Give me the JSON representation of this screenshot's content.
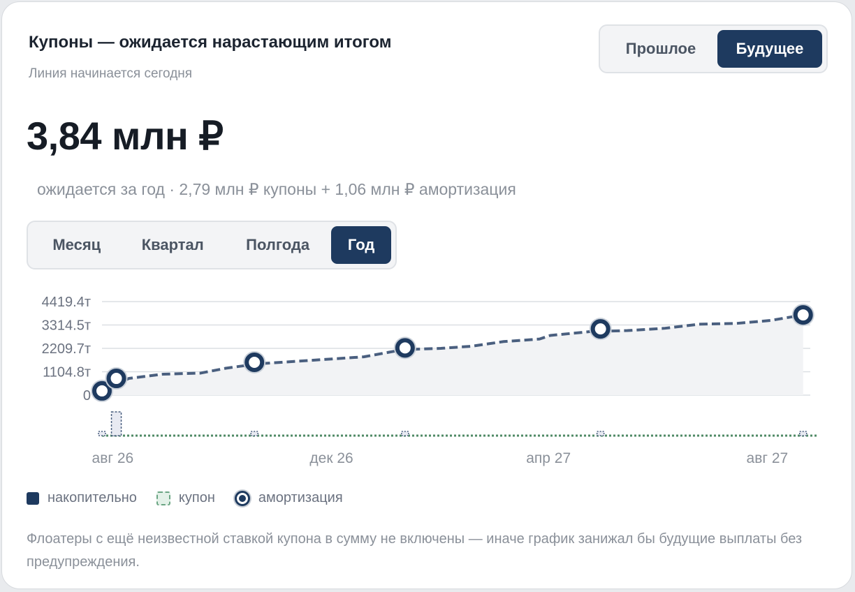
{
  "header": {
    "title": "Купоны — ожидается нарастающим итогом",
    "subtitle": "Линия начинается сегодня"
  },
  "time_toggle": {
    "options": [
      "Прошлое",
      "Будущее"
    ],
    "selected": "Будущее"
  },
  "summary": {
    "value": "3,84 млн ₽",
    "caption": "ожидается за год · 2,79 млн ₽ купоны + 1,06 млн ₽ амортизация"
  },
  "period_toggle": {
    "options": [
      "Месяц",
      "Квартал",
      "Полгода",
      "Год"
    ],
    "selected": "Год"
  },
  "legend": {
    "cumulative": "накопительно",
    "coupon": "купон",
    "amortization": "амортизация"
  },
  "footnote": "Флоатеры с ещё неизвестной ставкой купона в сумму не включены — иначе график занижал бы будущие выплаты без предупреждения.",
  "colors": {
    "accent": "#1e3a5f",
    "line": "#4a5f7f",
    "area": "#f2f3f5",
    "coupon": "#4f8a65",
    "grid": "#dcdfe3"
  },
  "chart_data": {
    "type": "line",
    "y_ticks": [
      "4419.4т",
      "3314.5т",
      "2209.7т",
      "1104.8т",
      "0"
    ],
    "y_tick_values": [
      4419.4,
      3314.5,
      2209.7,
      1104.8,
      0
    ],
    "x_ticks": [
      "авг 26",
      "дек 26",
      "апр 27",
      "авг 27"
    ],
    "x_tick_values": [
      "2026-08-07",
      "2026-12-07",
      "2027-04-07",
      "2027-08-07"
    ],
    "ylim": [
      0,
      4419.4
    ],
    "xlim": [
      "2026-08-01",
      "2027-08-31"
    ],
    "series": [
      {
        "name": "накопительно",
        "x": [
          "2026-08-01",
          "2026-08-16",
          "2026-09-04",
          "2026-09-25",
          "2026-10-09",
          "2026-10-27",
          "2026-11-25",
          "2026-12-25",
          "2027-01-16",
          "2027-02-06",
          "2027-02-23",
          "2027-03-13",
          "2027-04-02",
          "2027-04-08",
          "2027-04-30",
          "2027-05-21",
          "2027-06-11",
          "2027-06-30",
          "2027-07-21",
          "2027-08-09",
          "2027-08-27"
        ],
        "values": [
          200,
          790,
          990,
          1040,
          1270,
          1480,
          1640,
          1810,
          2150,
          2210,
          2310,
          2530,
          2650,
          2820,
          3000,
          3050,
          3160,
          3350,
          3390,
          3530,
          3790
        ]
      },
      {
        "name": "амортизация",
        "x": [
          "2026-08-01",
          "2026-08-09",
          "2026-10-25",
          "2027-01-17",
          "2027-05-06",
          "2027-08-27"
        ],
        "values": [
          200,
          790,
          1550,
          2230,
          3130,
          3790
        ]
      }
    ],
    "coupon_markers_x": [
      "2026-08-01",
      "2026-08-09",
      "2026-10-25",
      "2027-01-17",
      "2027-05-06",
      "2027-08-27"
    ],
    "coupon_tall_marker_x": "2026-08-09"
  }
}
